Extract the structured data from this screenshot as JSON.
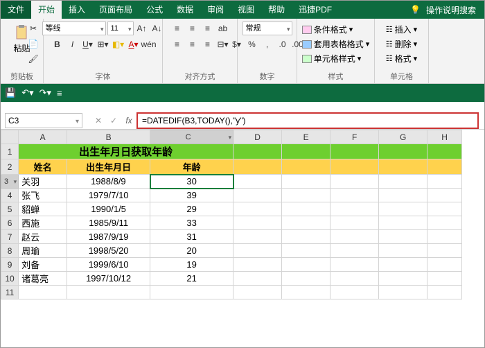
{
  "tabs": {
    "file": "文件",
    "home": "开始",
    "insert": "插入",
    "layout": "页面布局",
    "formulas": "公式",
    "data": "数据",
    "review": "审阅",
    "view": "视图",
    "help": "帮助",
    "pdf": "迅捷PDF"
  },
  "search": "操作说明搜索",
  "ribbon": {
    "clipboard": {
      "paste": "粘贴",
      "label": "剪贴板"
    },
    "font": {
      "name": "等线",
      "size": "11",
      "label": "字体"
    },
    "align": {
      "label": "对齐方式"
    },
    "number": {
      "format": "常规",
      "label": "数字"
    },
    "styles": {
      "cond": "条件格式",
      "table": "套用表格格式",
      "cell": "单元格样式",
      "label": "样式"
    },
    "cells": {
      "insert": "插入",
      "delete": "删除",
      "format": "格式",
      "label": "单元格"
    }
  },
  "namebox": "C3",
  "formula": "=DATEDIF(B3,TODAY(),\"y\")",
  "cols": [
    "A",
    "B",
    "C",
    "D",
    "E",
    "F",
    "G",
    "H"
  ],
  "title": "出生年月日获取年龄",
  "headers": {
    "name": "姓名",
    "dob": "出生年月日",
    "age": "年龄"
  },
  "rows": [
    {
      "n": "关羽",
      "d": "1988/8/9",
      "a": "30"
    },
    {
      "n": "张飞",
      "d": "1979/7/10",
      "a": "39"
    },
    {
      "n": "貂蝉",
      "d": "1990/1/5",
      "a": "29"
    },
    {
      "n": "西施",
      "d": "1985/9/11",
      "a": "33"
    },
    {
      "n": "赵云",
      "d": "1987/9/19",
      "a": "31"
    },
    {
      "n": "周瑜",
      "d": "1998/5/20",
      "a": "20"
    },
    {
      "n": "刘备",
      "d": "1999/6/10",
      "a": "19"
    },
    {
      "n": "诸葛亮",
      "d": "1997/10/12",
      "a": "21"
    }
  ]
}
